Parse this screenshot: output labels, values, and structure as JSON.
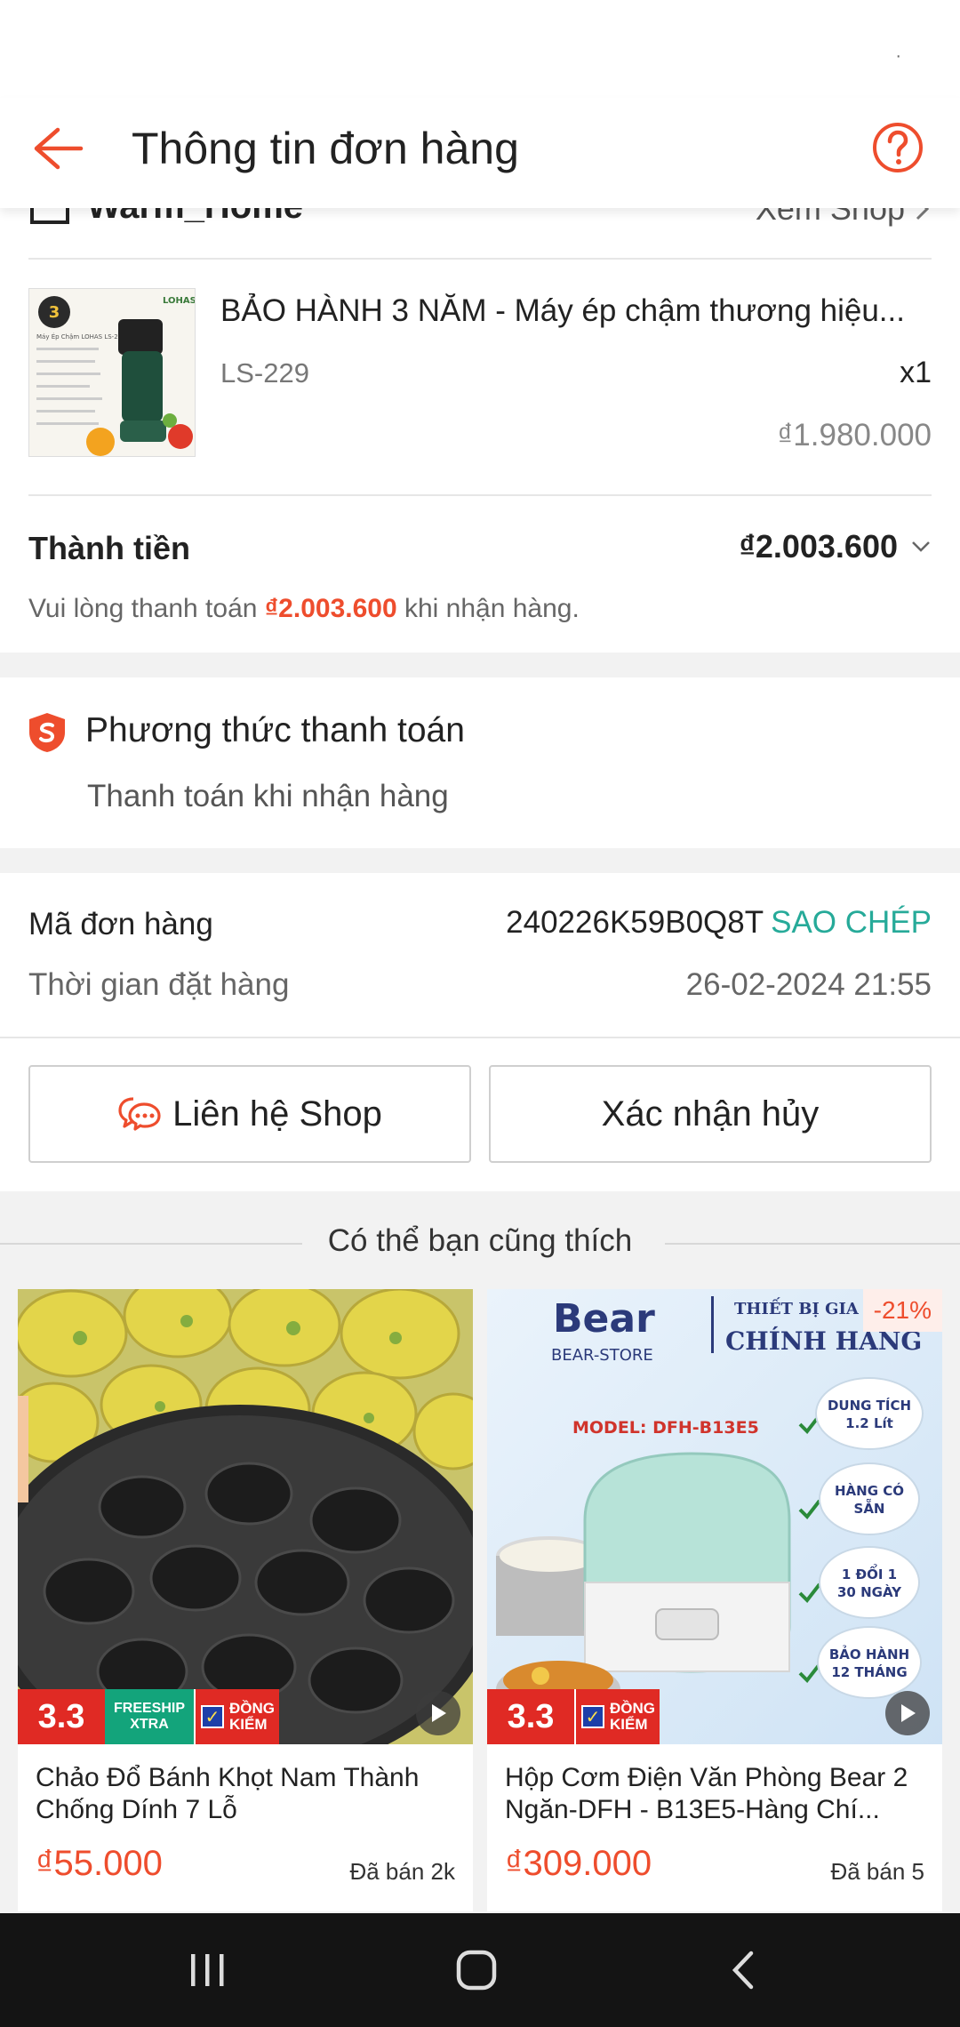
{
  "header": {
    "title": "Thông tin đơn hàng",
    "back_icon": "arrow-left-icon",
    "help_icon": "question-circle-icon",
    "accent": "#ee4d2d"
  },
  "shop": {
    "name": "Warm_Home",
    "view_label": "Xem Shop"
  },
  "product": {
    "title": "BẢO HÀNH 3 NĂM - Máy ép chậm thương hiệu...",
    "variant": "LS-229",
    "quantity": "x1",
    "price": "₫1.980.000",
    "image_brand": "LOHAS",
    "image_caption": "Máy Ép Chậm LOHAS LS-229"
  },
  "total": {
    "label": "Thành tiền",
    "value": "₫2.003.600",
    "note_prefix": "Vui lòng thanh toán ",
    "note_amount": "₫2.003.600",
    "note_suffix": " khi nhận hàng."
  },
  "payment": {
    "title": "Phương thức thanh toán",
    "method": "Thanh toán khi nhận hàng"
  },
  "order": {
    "code_label": "Mã đơn hàng",
    "code_value": "240226K59B0Q8T",
    "copy_label": "SAO CHÉP",
    "time_label": "Thời gian đặt hàng",
    "time_value": "26-02-2024 21:55"
  },
  "actions": {
    "contact_label": "Liên hệ Shop",
    "cancel_label": "Xác nhận hủy"
  },
  "recommendations": {
    "title": "Có thể bạn cũng thích",
    "items": [
      {
        "name": "Chảo Đổ Bánh Khọt Nam Thành Chống Dính 7 Lỗ",
        "price": "₫55.000",
        "sold": "Đã bán 2k",
        "badge_sale": "3.3",
        "badge_freeship_1": "FREESHIP",
        "badge_freeship_2": "XTRA",
        "badge_checked": "ĐỒNG KIỂM"
      },
      {
        "name": "Hộp Cơm Điện Văn Phòng Bear 2 Ngăn-DFH - B13E5-Hàng Chí...",
        "price": "₫309.000",
        "sold": "Đã bán 5",
        "discount": "-21%",
        "badge_sale": "3.3",
        "badge_checked": "ĐỒNG KIỂM",
        "image_brand": "Bear",
        "image_store": "BEAR-STORE",
        "image_tag1": "THIẾT BỊ GIA",
        "image_tag2": "CHÍNH HÃNG",
        "image_model": "MODEL: DFH-B13E5",
        "features": [
          "DUNG TÍCH 1.2 Lít",
          "HÀNG CÓ SẴN",
          "1 ĐỔI 1 30 NGÀY",
          "BẢO HÀNH 12 THÁNG"
        ]
      }
    ]
  },
  "navbar": {
    "recent_icon": "recent-apps-icon",
    "home_icon": "home-icon",
    "back_icon": "nav-back-icon"
  }
}
